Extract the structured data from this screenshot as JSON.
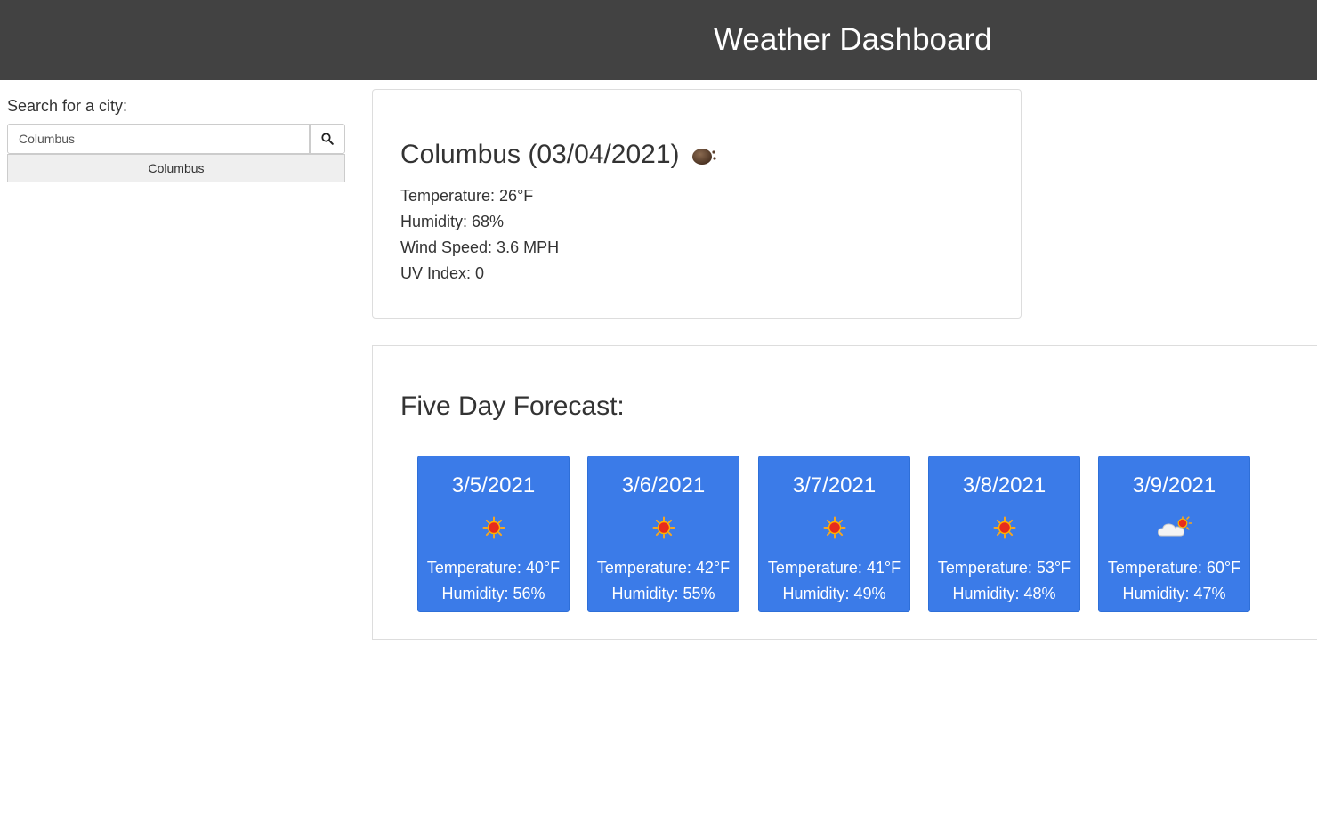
{
  "header": {
    "title": "Weather Dashboard"
  },
  "search": {
    "label": "Search for a city:",
    "input_value": "Columbus",
    "button_icon": "search-icon",
    "history": [
      "Columbus"
    ]
  },
  "current": {
    "heading": "Columbus (03/04/2021)",
    "icon": "clear-night-moon-icon",
    "temperature": "Temperature: 26°F",
    "humidity": "Humidity: 68%",
    "wind": "Wind Speed: 3.6 MPH",
    "uv": "UV Index: 0"
  },
  "forecast": {
    "heading": "Five Day Forecast:",
    "days": [
      {
        "date": "3/5/2021",
        "icon": "sun-icon",
        "temperature": "Temperature: 40°F",
        "humidity": "Humidity: 56%"
      },
      {
        "date": "3/6/2021",
        "icon": "sun-icon",
        "temperature": "Temperature: 42°F",
        "humidity": "Humidity: 55%"
      },
      {
        "date": "3/7/2021",
        "icon": "sun-icon",
        "temperature": "Temperature: 41°F",
        "humidity": "Humidity: 49%"
      },
      {
        "date": "3/8/2021",
        "icon": "sun-icon",
        "temperature": "Temperature: 53°F",
        "humidity": "Humidity: 48%"
      },
      {
        "date": "3/9/2021",
        "icon": "cloud-sun-icon",
        "temperature": "Temperature: 60°F",
        "humidity": "Humidity: 47%"
      }
    ]
  },
  "colors": {
    "header_bg": "#424242",
    "card_blue": "#3b7be8",
    "text": "#333333"
  }
}
